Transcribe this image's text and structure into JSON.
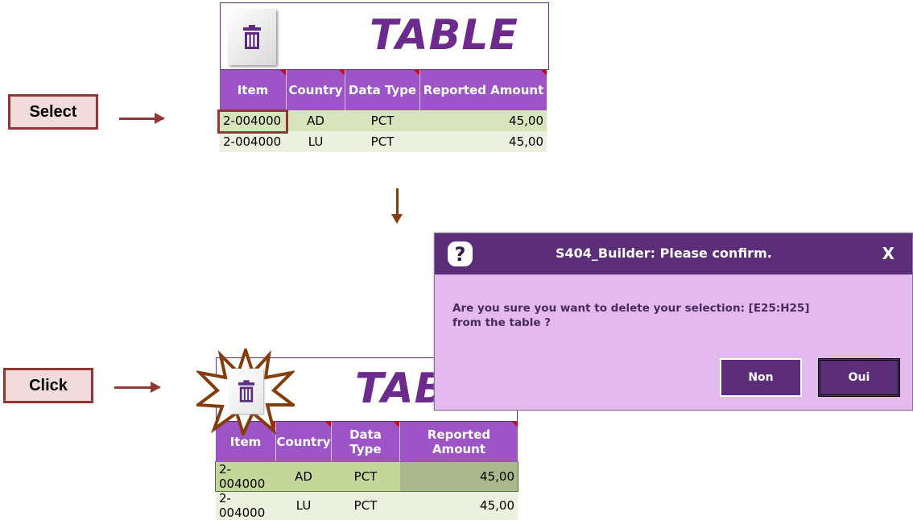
{
  "steps": {
    "select_label": "Select",
    "click_label": "Click"
  },
  "table": {
    "title": "TABLE",
    "title_partial": "TAB",
    "headers": [
      "Item",
      "Country",
      "Data Type",
      "Reported Amount"
    ],
    "rows": [
      [
        "2-004000",
        "AD",
        "PCT",
        "45,00"
      ],
      [
        "2-004000",
        "LU",
        "PCT",
        "45,00"
      ]
    ],
    "trash_icon": "trash-icon"
  },
  "dialog": {
    "icon": "question-icon",
    "icon_glyph": "?",
    "title": "S404_Builder: Please confirm.",
    "close_label": "X",
    "message_line1": "Are you sure you want to delete your selection: [E25:H25]",
    "message_line2": "from the table ?",
    "button_no": "Non",
    "button_yes": "Oui"
  },
  "colors": {
    "accent": "#9d54c7",
    "title_purple": "#6b2a8c",
    "dialog_bar": "#5c2d78",
    "dialog_body": "#e3b9ee",
    "step_border": "#943634",
    "step_fill": "#f2dcdb"
  }
}
